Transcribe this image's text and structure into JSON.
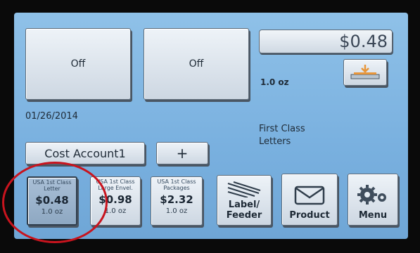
{
  "top_buttons": [
    {
      "label": "Off"
    },
    {
      "label": "Off"
    }
  ],
  "postage": {
    "amount": "$0.48",
    "weight": "1.0 oz"
  },
  "date": "01/26/2014",
  "mail_class": {
    "line1": "First Class",
    "line2": "Letters"
  },
  "account": {
    "label": "Cost Account1",
    "add_label": "+"
  },
  "presets": [
    {
      "line1": "USA 1st Class",
      "line2": "Letter",
      "price": "$0.48",
      "weight": "1.0 oz",
      "selected": true
    },
    {
      "line1": "USA 1st Class",
      "line2": "Large Envel.",
      "price": "$0.98",
      "weight": "1.0 oz",
      "selected": false
    },
    {
      "line1": "USA 1st Class",
      "line2": "Packages",
      "price": "$2.32",
      "weight": "1.0 oz",
      "selected": false
    }
  ],
  "tools": [
    {
      "line1": "Label/",
      "line2": "Feeder",
      "icon": "label-feeder-icon"
    },
    {
      "line1": "Product",
      "icon": "envelope-icon"
    },
    {
      "line1": "Menu",
      "icon": "gears-icon"
    }
  ],
  "colors": {
    "screen": "#7fb5e2",
    "highlight_circle": "#c8141e",
    "icon_orange": "#e8963a"
  }
}
